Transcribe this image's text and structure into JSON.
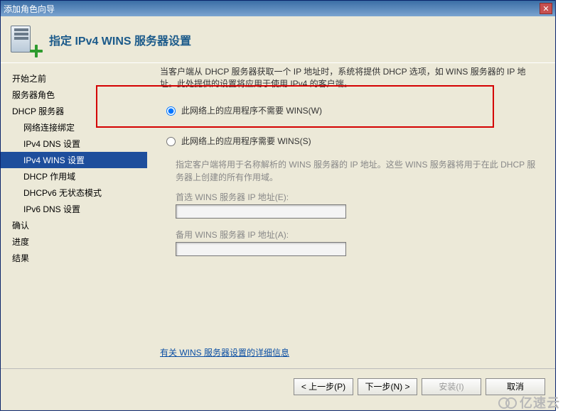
{
  "window": {
    "title": "添加角色向导"
  },
  "header": {
    "title": "指定 IPv4 WINS 服务器设置"
  },
  "sidebar": {
    "items": [
      {
        "label": "开始之前",
        "sub": false,
        "selected": false
      },
      {
        "label": "服务器角色",
        "sub": false,
        "selected": false
      },
      {
        "label": "DHCP 服务器",
        "sub": false,
        "selected": false
      },
      {
        "label": "网络连接绑定",
        "sub": true,
        "selected": false
      },
      {
        "label": "IPv4 DNS 设置",
        "sub": true,
        "selected": false
      },
      {
        "label": "IPv4 WINS 设置",
        "sub": true,
        "selected": true
      },
      {
        "label": "DHCP 作用域",
        "sub": true,
        "selected": false
      },
      {
        "label": "DHCPv6 无状态模式",
        "sub": true,
        "selected": false
      },
      {
        "label": "IPv6 DNS 设置",
        "sub": true,
        "selected": false
      },
      {
        "label": "确认",
        "sub": false,
        "selected": false
      },
      {
        "label": "进度",
        "sub": false,
        "selected": false
      },
      {
        "label": "结果",
        "sub": false,
        "selected": false
      }
    ]
  },
  "content": {
    "description": "当客户端从 DHCP 服务器获取一个 IP 地址时，系统将提供 DHCP 选项，如 WINS 服务器的 IP 地址。此处提供的设置将应用于使用 IPv4 的客户端。",
    "radio_no_wins": "此网络上的应用程序不需要 WINS(W)",
    "radio_need_wins": "此网络上的应用程序需要 WINS(S)",
    "selected_radio": "no_wins",
    "hint": "指定客户端将用于名称解析的 WINS 服务器的 IP 地址。这些 WINS 服务器将用于在此 DHCP 服务器上创建的所有作用域。",
    "preferred_label": "首选 WINS 服务器 IP 地址(E):",
    "preferred_value": "",
    "alternate_label": "备用 WINS 服务器 IP 地址(A):",
    "alternate_value": "",
    "more_link": "有关 WINS 服务器设置的详细信息"
  },
  "footer": {
    "prev": "< 上一步(P)",
    "next": "下一步(N) >",
    "install": "安装(I)",
    "cancel": "取消"
  },
  "watermark": "亿速云"
}
